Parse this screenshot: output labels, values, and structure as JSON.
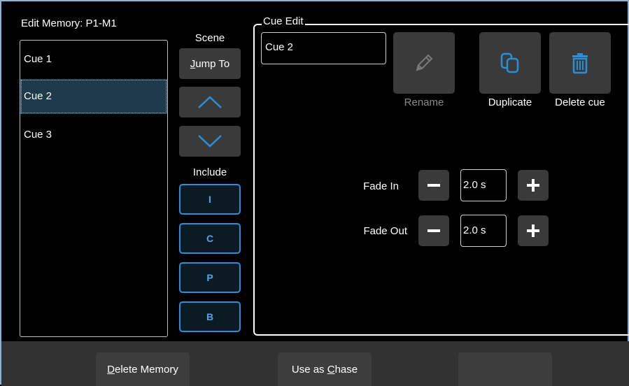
{
  "title": "Edit Memory: P1-M1",
  "cues": [
    {
      "label": "Cue 1",
      "selected": false
    },
    {
      "label": "Cue 2",
      "selected": true
    },
    {
      "label": "Cue 3",
      "selected": false
    }
  ],
  "scene": {
    "label": "Scene",
    "jump_to": {
      "pre": "",
      "ul": "J",
      "post": "ump To"
    },
    "up_icon": "chevron-up-icon",
    "down_icon": "chevron-down-icon"
  },
  "include": {
    "label": "Include",
    "buttons": [
      "I",
      "C",
      "P",
      "B"
    ]
  },
  "cue_edit": {
    "legend": "Cue Edit",
    "name_value": "Cue 2",
    "rename_label": "Rename",
    "duplicate_label": "Duplicate",
    "delete_label": "Delete cue",
    "fade_in_label": "Fade In",
    "fade_in_value": "2.0 s",
    "fade_out_label": "Fade Out",
    "fade_out_value": "2.0 s"
  },
  "bottom": {
    "delete_memory": {
      "pre": "",
      "ul": "D",
      "post": "elete Memory"
    },
    "use_as_chase": {
      "pre": "Use as ",
      "ul": "C",
      "post": "hase"
    },
    "blank": ""
  },
  "colors": {
    "accent": "#2a8fd8",
    "selected_row": "#1f3a4a",
    "button_bg": "#3a3a3a",
    "disabled_text": "#8a8a8a"
  }
}
